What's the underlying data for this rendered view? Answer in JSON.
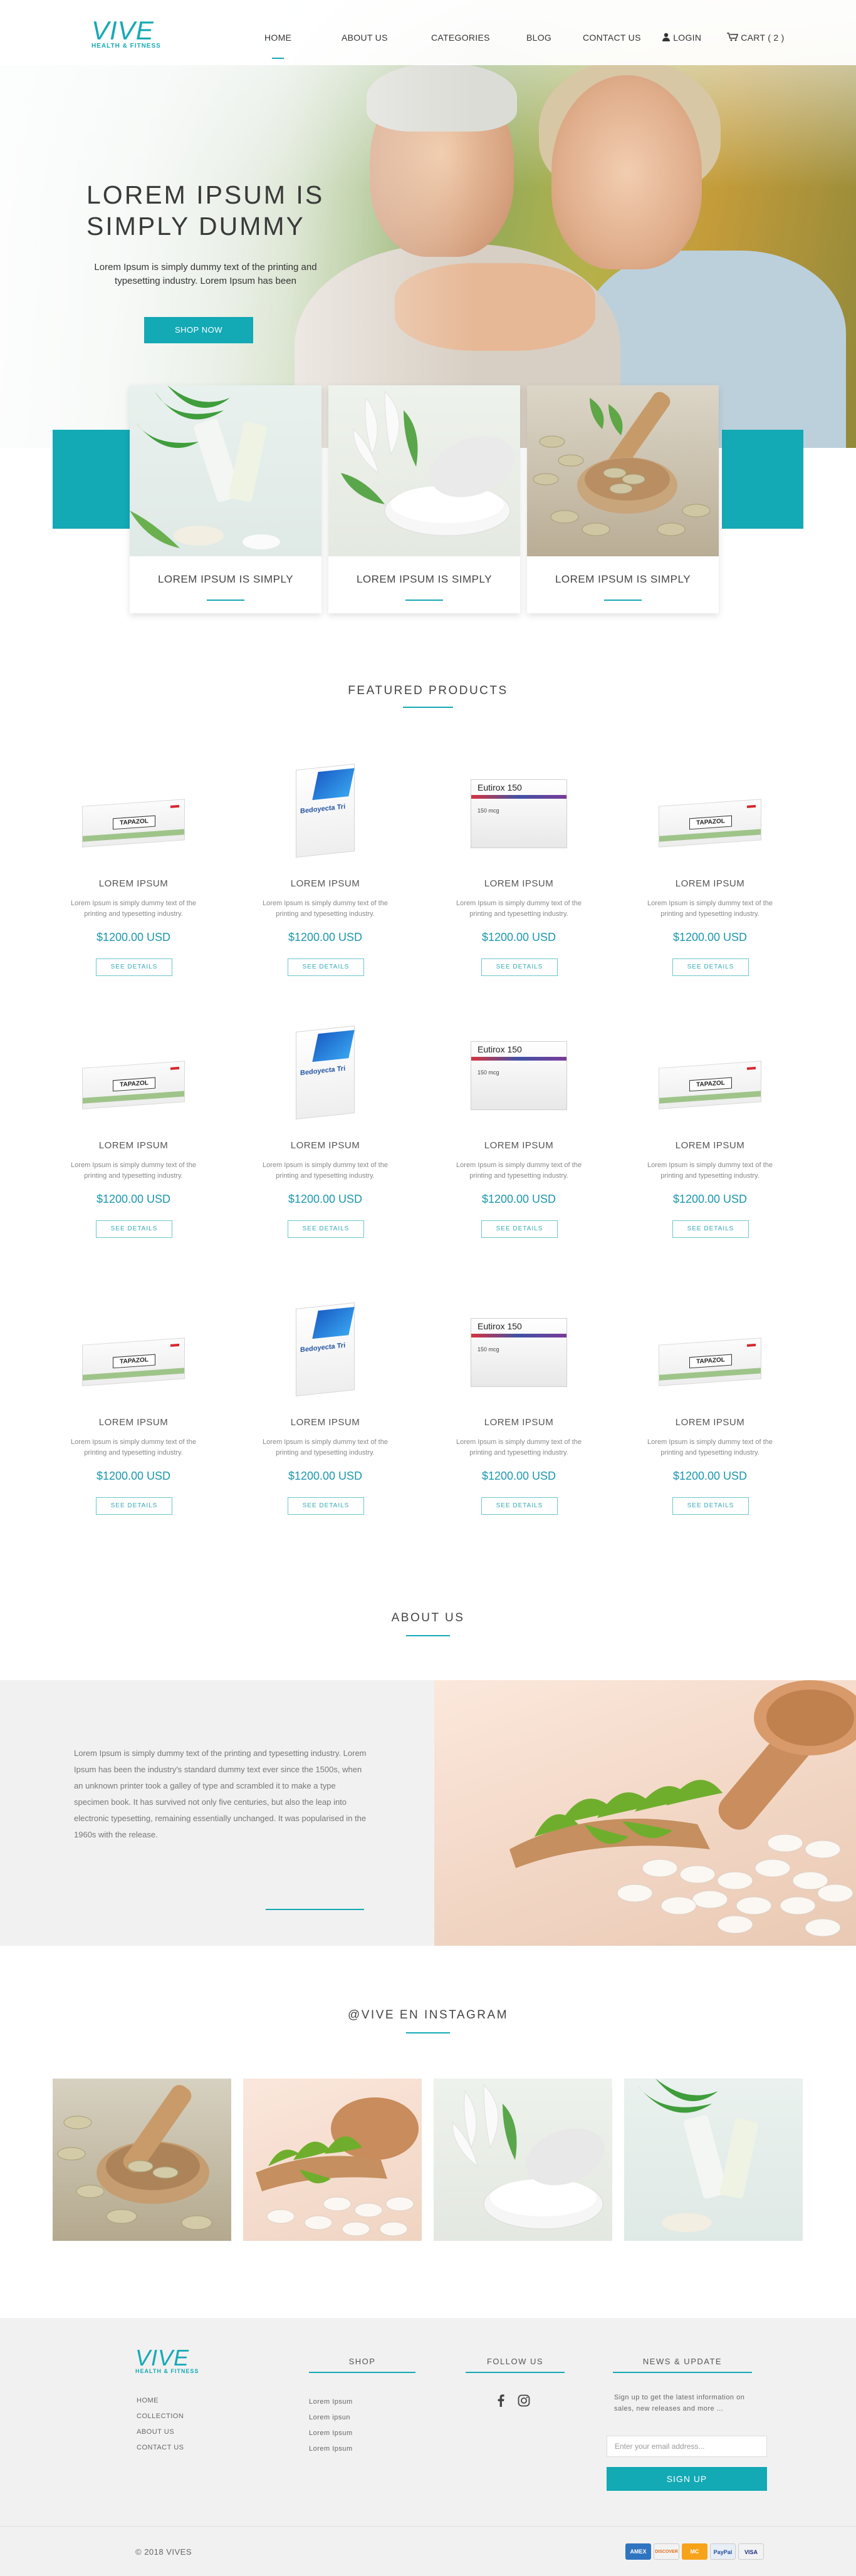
{
  "header": {
    "logo": {
      "word": "VIVE",
      "tagline": "HEALTH & FITNESS"
    },
    "nav": [
      {
        "label": "HOME",
        "active": true
      },
      {
        "label": "ABOUT US"
      },
      {
        "label": "CATEGORIES"
      },
      {
        "label": "BLOG"
      },
      {
        "label": "CONTACT US"
      }
    ],
    "login_label": "LOGIN",
    "cart_label": "CART ( 2 )"
  },
  "hero": {
    "title_line1": "LOREM IPSUM IS",
    "title_line2": "SIMPLY DUMMY",
    "text": "Lorem Ipsum is simply dummy text of the printing and typesetting industry. Lorem Ipsum has been",
    "button_label": "SHOP NOW"
  },
  "features": [
    {
      "label": "LOREM IPSUM IS SIMPLY"
    },
    {
      "label": "LOREM IPSUM IS SIMPLY"
    },
    {
      "label": "LOREM IPSUM IS SIMPLY"
    }
  ],
  "featured": {
    "title": "FEATURED PRODUCTS",
    "products": [
      {
        "name": "LOREM IPSUM",
        "desc": "Lorem Ipsum is simply dummy text of the printing and typesetting industry.",
        "price": "$1200.00 USD",
        "button": "SEE DETAILS",
        "box_label": "TAPAZOL"
      },
      {
        "name": "LOREM IPSUM",
        "desc": "Lorem Ipsum is simply dummy text of the printing and typesetting industry.",
        "price": "$1200.00 USD",
        "button": "SEE DETAILS",
        "box_label": "Bedoyecta Tri"
      },
      {
        "name": "LOREM IPSUM",
        "desc": "Lorem Ipsum is simply dummy text of the printing and typesetting industry.",
        "price": "$1200.00 USD",
        "button": "SEE DETAILS",
        "box_label": "Eutirox 150",
        "box_dose": "150 mcg"
      },
      {
        "name": "LOREM IPSUM",
        "desc": "Lorem Ipsum is simply dummy text of the printing and typesetting industry.",
        "price": "$1200.00 USD",
        "button": "SEE DETAILS",
        "box_label": "TAPAZOL"
      },
      {
        "name": "LOREM IPSUM",
        "desc": "Lorem Ipsum is simply dummy text of the printing and typesetting industry.",
        "price": "$1200.00 USD",
        "button": "SEE DETAILS",
        "box_label": "TAPAZOL"
      },
      {
        "name": "LOREM IPSUM",
        "desc": "Lorem Ipsum is simply dummy text of the printing and typesetting industry.",
        "price": "$1200.00 USD",
        "button": "SEE DETAILS",
        "box_label": "Bedoyecta Tri"
      },
      {
        "name": "LOREM IPSUM",
        "desc": "Lorem Ipsum is simply dummy text of the printing and typesetting industry.",
        "price": "$1200.00 USD",
        "button": "SEE DETAILS",
        "box_label": "Eutirox 150",
        "box_dose": "150 mcg"
      },
      {
        "name": "LOREM IPSUM",
        "desc": "Lorem Ipsum is simply dummy text of the printing and typesetting industry.",
        "price": "$1200.00 USD",
        "button": "SEE DETAILS",
        "box_label": "TAPAZOL"
      },
      {
        "name": "LOREM IPSUM",
        "desc": "Lorem Ipsum is simply dummy text of the printing and typesetting industry.",
        "price": "$1200.00 USD",
        "button": "SEE DETAILS",
        "box_label": "TAPAZOL"
      },
      {
        "name": "LOREM IPSUM",
        "desc": "Lorem Ipsum is simply dummy text of the printing and typesetting industry.",
        "price": "$1200.00 USD",
        "button": "SEE DETAILS",
        "box_label": "Bedoyecta Tri"
      },
      {
        "name": "LOREM IPSUM",
        "desc": "Lorem Ipsum is simply dummy text of the printing and typesetting industry.",
        "price": "$1200.00 USD",
        "button": "SEE DETAILS",
        "box_label": "Eutirox 150",
        "box_dose": "150 mcg"
      },
      {
        "name": "LOREM IPSUM",
        "desc": "Lorem Ipsum is simply dummy text of the printing and typesetting industry.",
        "price": "$1200.00 USD",
        "button": "SEE DETAILS",
        "box_label": "TAPAZOL"
      }
    ]
  },
  "about": {
    "title": "ABOUT US",
    "text": "Lorem Ipsum is simply dummy text of the printing and typesetting industry. Lorem Ipsum has been the industry's standard dummy text ever since the 1500s, when an unknown printer took a galley of type and scrambled it to make a type specimen book. It has survived not only five centuries, but also the leap into electronic typesetting, remaining essentially unchanged. It was popularised in the 1960s with the release."
  },
  "instagram": {
    "title": "@VIVE EN INSTAGRAM"
  },
  "footer": {
    "links": [
      "HOME",
      "COLLECTION",
      "ABOUT US",
      "CONTACT US"
    ],
    "shop": {
      "title": "SHOP",
      "items": [
        "Lorem Ipsum",
        "Lorem ipsun",
        "Lorem Ipsum",
        "Lorem Ipsum"
      ]
    },
    "follow": {
      "title": "FOLLOW US"
    },
    "news": {
      "title": "NEWS & UPDATE",
      "text": "Sign up to get the latest information on sales, new releases and more ...",
      "placeholder": "Enter your email address...",
      "button": "SIGN UP"
    },
    "copyright": "© 2018 VIVES",
    "payments": [
      "AMEX",
      "DISCOVER",
      "MASTERCARD",
      "PAYPAL",
      "VISA"
    ]
  },
  "colors": {
    "accent": "#13a9b5",
    "price": "#1b97ad",
    "footer_bg": "#f1f1f1"
  }
}
